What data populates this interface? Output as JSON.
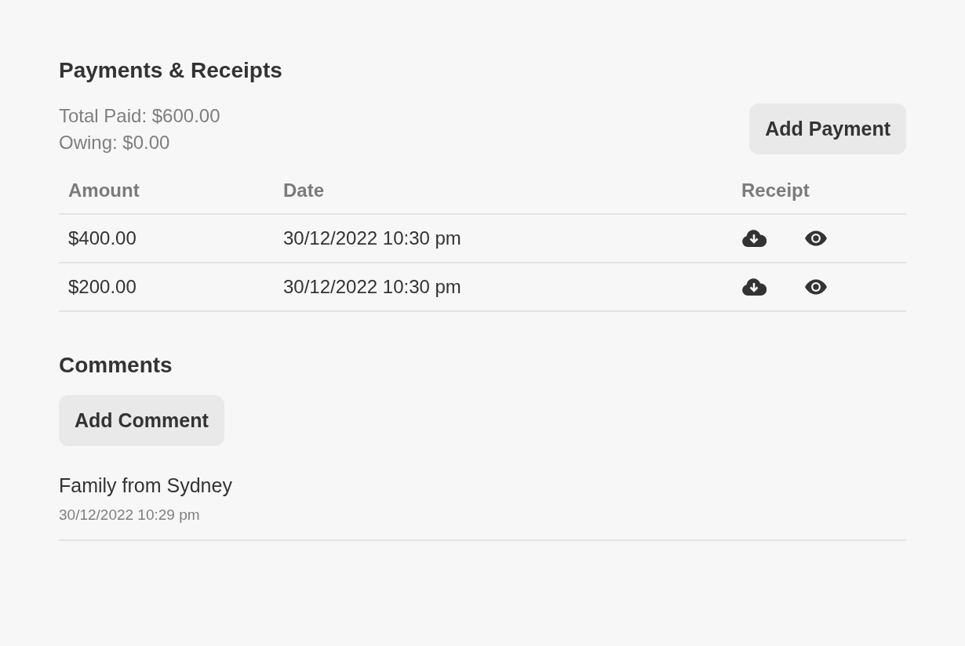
{
  "payments": {
    "title": "Payments & Receipts",
    "total_paid": "Total Paid: $600.00",
    "owing": "Owing: $0.00",
    "add_button": "Add Payment",
    "columns": [
      "Amount",
      "Date",
      "Receipt"
    ],
    "rows": [
      {
        "amount": "$400.00",
        "date": "30/12/2022 10:30 pm"
      },
      {
        "amount": "$200.00",
        "date": "30/12/2022 10:30 pm"
      }
    ]
  },
  "comments": {
    "title": "Comments",
    "add_button": "Add Comment",
    "items": [
      {
        "text": "Family from Sydney",
        "time": "30/12/2022 10:29 pm"
      }
    ]
  }
}
